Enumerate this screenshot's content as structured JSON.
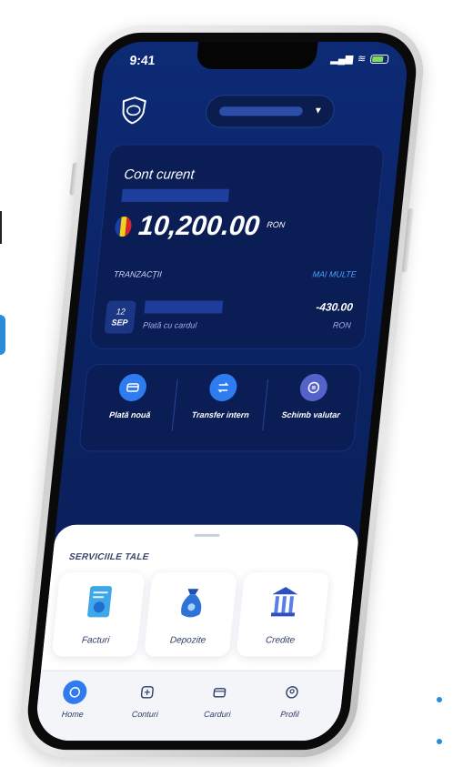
{
  "status_bar": {
    "time": "9:41"
  },
  "account": {
    "title": "Cont curent",
    "balance": "10,200.00",
    "currency": "RON"
  },
  "transactions": {
    "label": "TRANZACȚII",
    "more_label": "MAI MULTE",
    "items": [
      {
        "day": "12",
        "month": "SEP",
        "description": "Plată cu cardul",
        "amount": "-430.00",
        "currency": "RON"
      }
    ]
  },
  "actions": [
    {
      "label": "Plată nouă",
      "icon": "payment-icon",
      "color": "#2f7bf0"
    },
    {
      "label": "Transfer intern",
      "icon": "transfer-icon",
      "color": "#2f7bf0"
    },
    {
      "label": "Schimb valutar",
      "icon": "exchange-icon",
      "color": "#5562c9"
    }
  ],
  "services": {
    "title": "SERVICIILE TALE",
    "items": [
      {
        "label": "Facturi",
        "icon": "invoice-icon"
      },
      {
        "label": "Depozite",
        "icon": "money-bag-icon"
      },
      {
        "label": "Credite",
        "icon": "bank-icon"
      }
    ]
  },
  "tabbar": [
    {
      "label": "Home",
      "icon": "home-icon",
      "active": true
    },
    {
      "label": "Conturi",
      "icon": "accounts-icon",
      "active": false
    },
    {
      "label": "Carduri",
      "icon": "cards-icon",
      "active": false
    },
    {
      "label": "Profil",
      "icon": "profile-icon",
      "active": false
    }
  ],
  "colors": {
    "screen_bg": "#0d2a76",
    "accent": "#2f7bf0",
    "link": "#4aa3ff",
    "tab_active": "#2f7bf0"
  }
}
